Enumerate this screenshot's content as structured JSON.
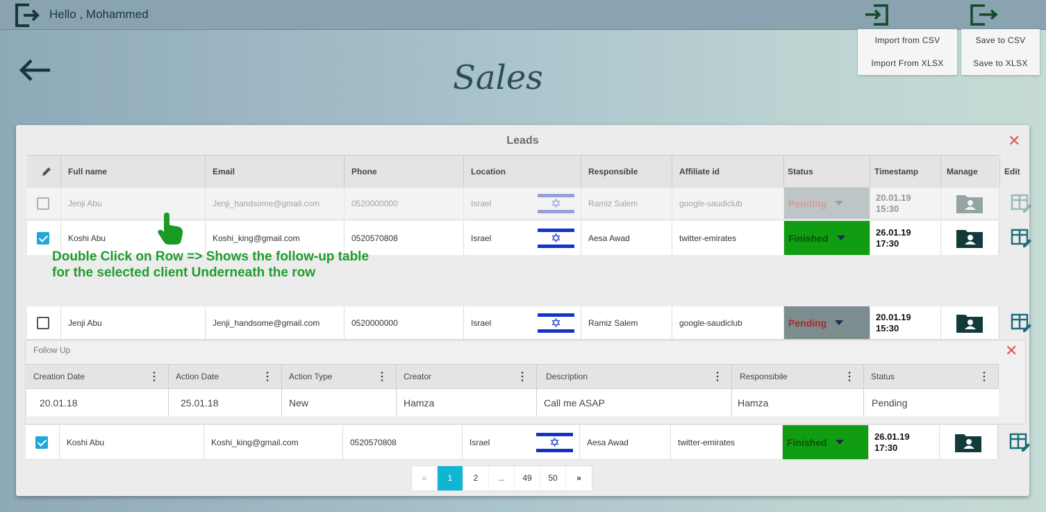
{
  "header": {
    "greeting": "Hello , Mohammed"
  },
  "import_menu": {
    "csv": "Import from CSV",
    "xlsx": "Import From XLSX"
  },
  "save_menu": {
    "csv": "Save to CSV",
    "xlsx": "Save to XLSX"
  },
  "page_title": "Sales",
  "panel_title": "Leads",
  "columns": [
    "Full name",
    "Email",
    "Phone",
    "Location",
    "Responsible",
    "Affiliate id",
    "Status",
    "Timestamp",
    "Manage",
    "Edit"
  ],
  "rows": [
    {
      "checked": false,
      "name": "Jenji Abu",
      "email": "Jenji_handsome@gmail.com",
      "phone": "0520000000",
      "location": "Israel",
      "responsible": "Ramiz Salem",
      "affiliate": "google-saudiclub",
      "status": "Pending",
      "date": "20.01.19",
      "time": "15:30"
    },
    {
      "checked": true,
      "name": "Koshi Abu",
      "email": "Koshi_king@gmail.com",
      "phone": "0520570808",
      "location": "Israel",
      "responsible": "Aesa Awad",
      "affiliate": "twitter-emirates",
      "status": "Finished",
      "date": "26.01.19",
      "time": "17:30"
    },
    {
      "checked": false,
      "name": "Jenji Abu",
      "email": "Jenji_handsome@gmail.com",
      "phone": "0520000000",
      "location": "Israel",
      "responsible": "Ramiz Salem",
      "affiliate": "google-saudiclub",
      "status": "Pending",
      "date": "20.01.19",
      "time": "15:30"
    },
    {
      "checked": true,
      "name": "Koshi Abu",
      "email": "Koshi_king@gmail.com",
      "phone": "0520570808",
      "location": "Israel",
      "responsible": "Aesa Awad",
      "affiliate": "twitter-emirates",
      "status": "Finished",
      "date": "26.01.19",
      "time": "17:30"
    }
  ],
  "annotation": {
    "line1": "Double Click on Row => Shows the follow-up table",
    "line2": "for the selected client Underneath the row"
  },
  "followup": {
    "title": "Follow Up",
    "columns": [
      "Creation Date",
      "Action Date",
      "Action Type",
      "Creator",
      "Description",
      "Responsibile",
      "Status"
    ],
    "row": [
      "20.01.18",
      "25.01.18",
      "New",
      "Hamza",
      "Call me ASAP",
      "Hamza",
      "Pending"
    ]
  },
  "pagination": {
    "prev": "«",
    "pages": [
      "1",
      "2",
      "...",
      "49",
      "50"
    ],
    "next": "»",
    "current": "1"
  },
  "colors": {
    "finished": "#119d11",
    "pending": "#7b8d8f",
    "active_page": "#10b5d3",
    "annotation": "#1f9c2c"
  }
}
